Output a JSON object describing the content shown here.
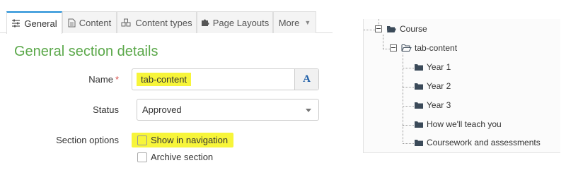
{
  "tabs": [
    {
      "label": "General",
      "icon": "sliders-icon",
      "active": true
    },
    {
      "label": "Content",
      "icon": "file-icon"
    },
    {
      "label": "Content types",
      "icon": "cubes-icon"
    },
    {
      "label": "Page Layouts",
      "icon": "puzzle-icon"
    },
    {
      "label": "More",
      "icon": "caret-down-icon"
    }
  ],
  "section_title": "General section details",
  "form": {
    "name_label": "Name",
    "required_mark": "*",
    "name_value": "tab-content",
    "name_addon": "A",
    "status_label": "Status",
    "status_value": "Approved",
    "section_options_label": "Section options",
    "show_in_navigation": "Show in navigation",
    "archive_section": "Archive section"
  },
  "tree": {
    "root": "Course",
    "child": "tab-content",
    "items": [
      "Year 1",
      "Year 2",
      "Year 3",
      "How we'll teach you",
      "Coursework and assessments"
    ]
  },
  "colors": {
    "highlight": "#f7f53a",
    "section_title": "#5ba84a",
    "active_tab_border": "#1f8dd6",
    "folder": "#3b4a59"
  }
}
